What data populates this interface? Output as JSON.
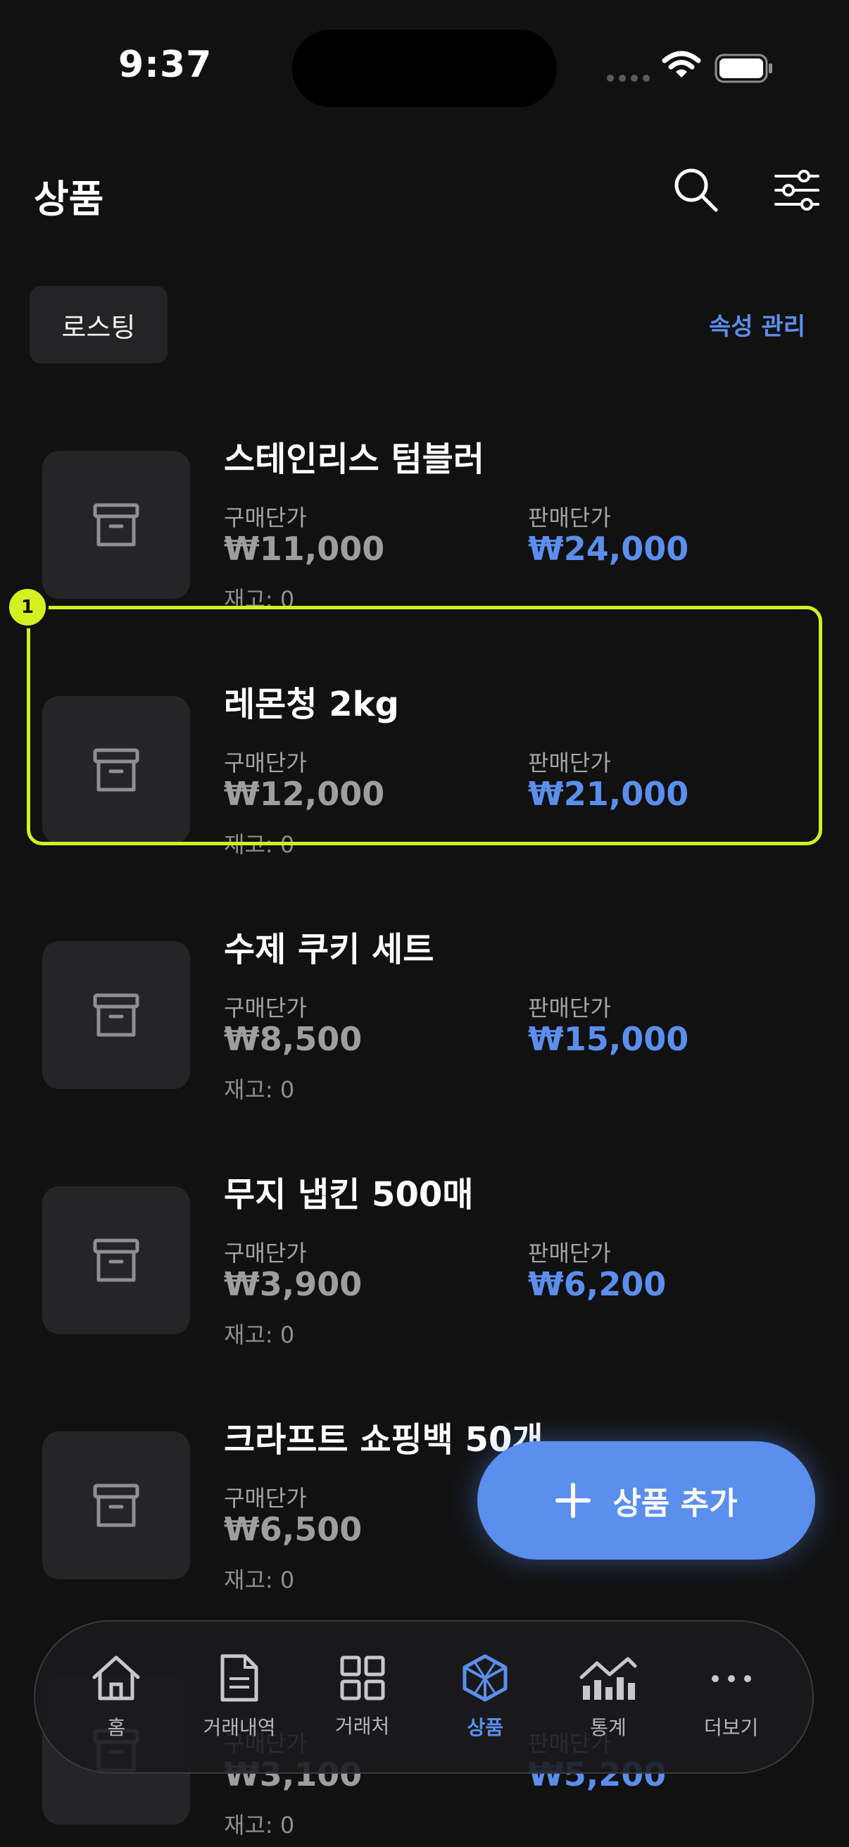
{
  "status": {
    "time": "9:37"
  },
  "header": {
    "title": "상품"
  },
  "filter": {
    "chip": "로스팅",
    "attr_link": "속성 관리"
  },
  "labels": {
    "buy": "구매단가",
    "sell": "판매단가"
  },
  "products": [
    {
      "name": "스테인리스 텀블러",
      "buy": "₩11,000",
      "sell": "₩24,000",
      "stock": "재고: 0"
    },
    {
      "name": "레몬청 2kg",
      "buy": "₩12,000",
      "sell": "₩21,000",
      "stock": "재고: 0"
    },
    {
      "name": "수제 쿠키 세트",
      "buy": "₩8,500",
      "sell": "₩15,000",
      "stock": "재고: 0"
    },
    {
      "name": "무지 냅킨 500매",
      "buy": "₩3,900",
      "sell": "₩6,200",
      "stock": "재고: 0"
    },
    {
      "name": "크라프트 쇼핑백 50개",
      "buy": "₩6,500",
      "sell": "",
      "stock": "재고: 0"
    },
    {
      "name": "",
      "buy": "₩3,100",
      "sell": "₩5,200",
      "stock": "재고: 0"
    }
  ],
  "highlight": {
    "badge": "1"
  },
  "fab": {
    "label": "상품 추가"
  },
  "tabs": [
    {
      "label": "홈",
      "icon": "home-icon"
    },
    {
      "label": "거래내역",
      "icon": "document-icon"
    },
    {
      "label": "거래처",
      "icon": "grid-icon"
    },
    {
      "label": "상품",
      "icon": "cube-icon"
    },
    {
      "label": "통계",
      "icon": "chart-icon"
    },
    {
      "label": "더보기",
      "icon": "more-icon"
    }
  ],
  "colors": {
    "accent": "#5b8fee",
    "highlight": "#d4f021",
    "background": "#111112"
  }
}
